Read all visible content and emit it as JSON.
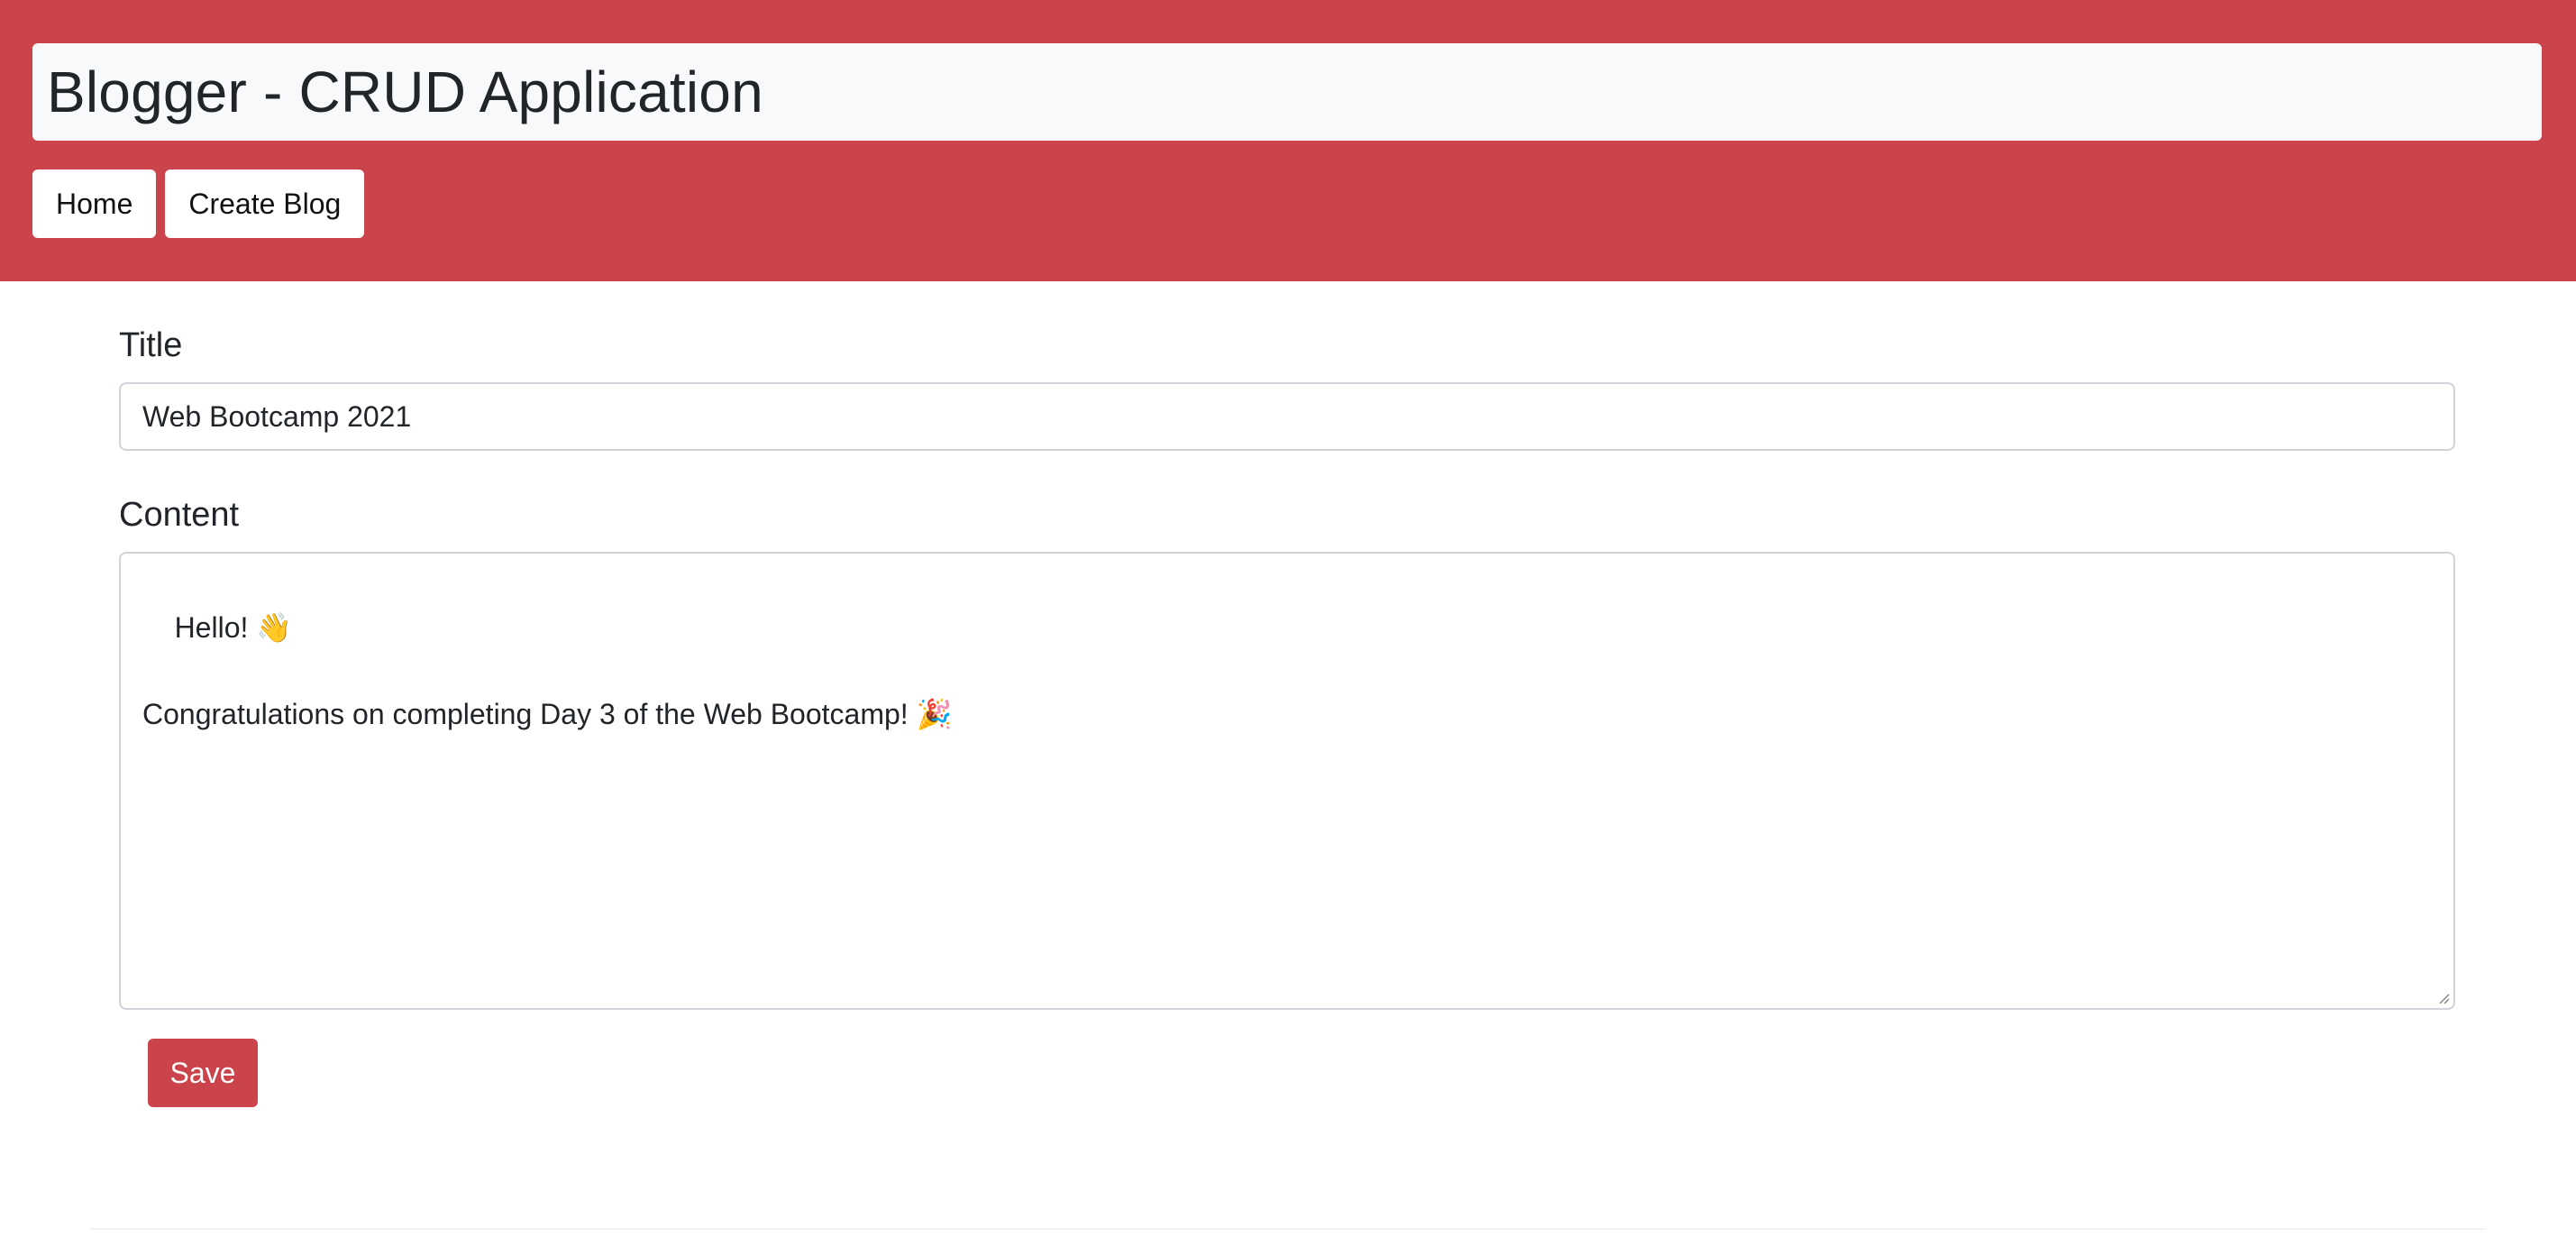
{
  "header": {
    "title": "Blogger - CRUD Application",
    "bg_color": "#cc444b",
    "nav": [
      {
        "label": "Home"
      },
      {
        "label": "Create Blog"
      }
    ]
  },
  "form": {
    "title_label": "Title",
    "title_value": "Web Bootcamp 2021",
    "content_label": "Content",
    "content_value": "Hello! 👋\n\nCongratulations on completing Day 3 of the Web Bootcamp! 🎉",
    "save_label": "Save"
  },
  "colors": {
    "accent": "#cc444b",
    "title_bar": "#f8f9fa",
    "input_border": "#ced4da"
  }
}
